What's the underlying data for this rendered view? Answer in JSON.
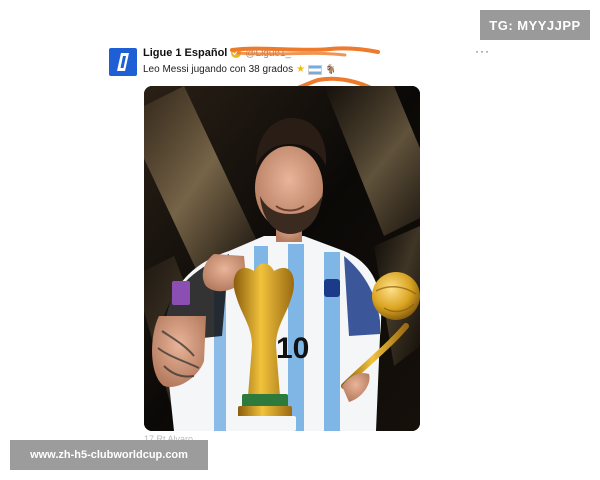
{
  "watermark_top": "TG: MYYJJPP",
  "watermark_bottom": "www.zh-h5-clubworldcup.com",
  "tweet": {
    "display_name": "Ligue 1 Español",
    "handle": "@Ligue1_",
    "text": "Leo Messi jugando con 38 grados",
    "more_label": "···",
    "avatar_icon": "ligue-1-logo",
    "verified_badge": "gold-verified-icon",
    "emojis": [
      "star-icon",
      "argentina-flag-icon",
      "goat-icon"
    ],
    "photo_caption": "17 Rt Alvaro"
  },
  "colors": {
    "avatar": "#1f5fd6",
    "verified": "#e9b82b",
    "scribble": "#ee7a2b",
    "watermark_bg": "#9a9a9a",
    "photo_bg": "#0c0a08",
    "jersey_blue": "#7fb6e6",
    "gold": "#d9a31f"
  }
}
